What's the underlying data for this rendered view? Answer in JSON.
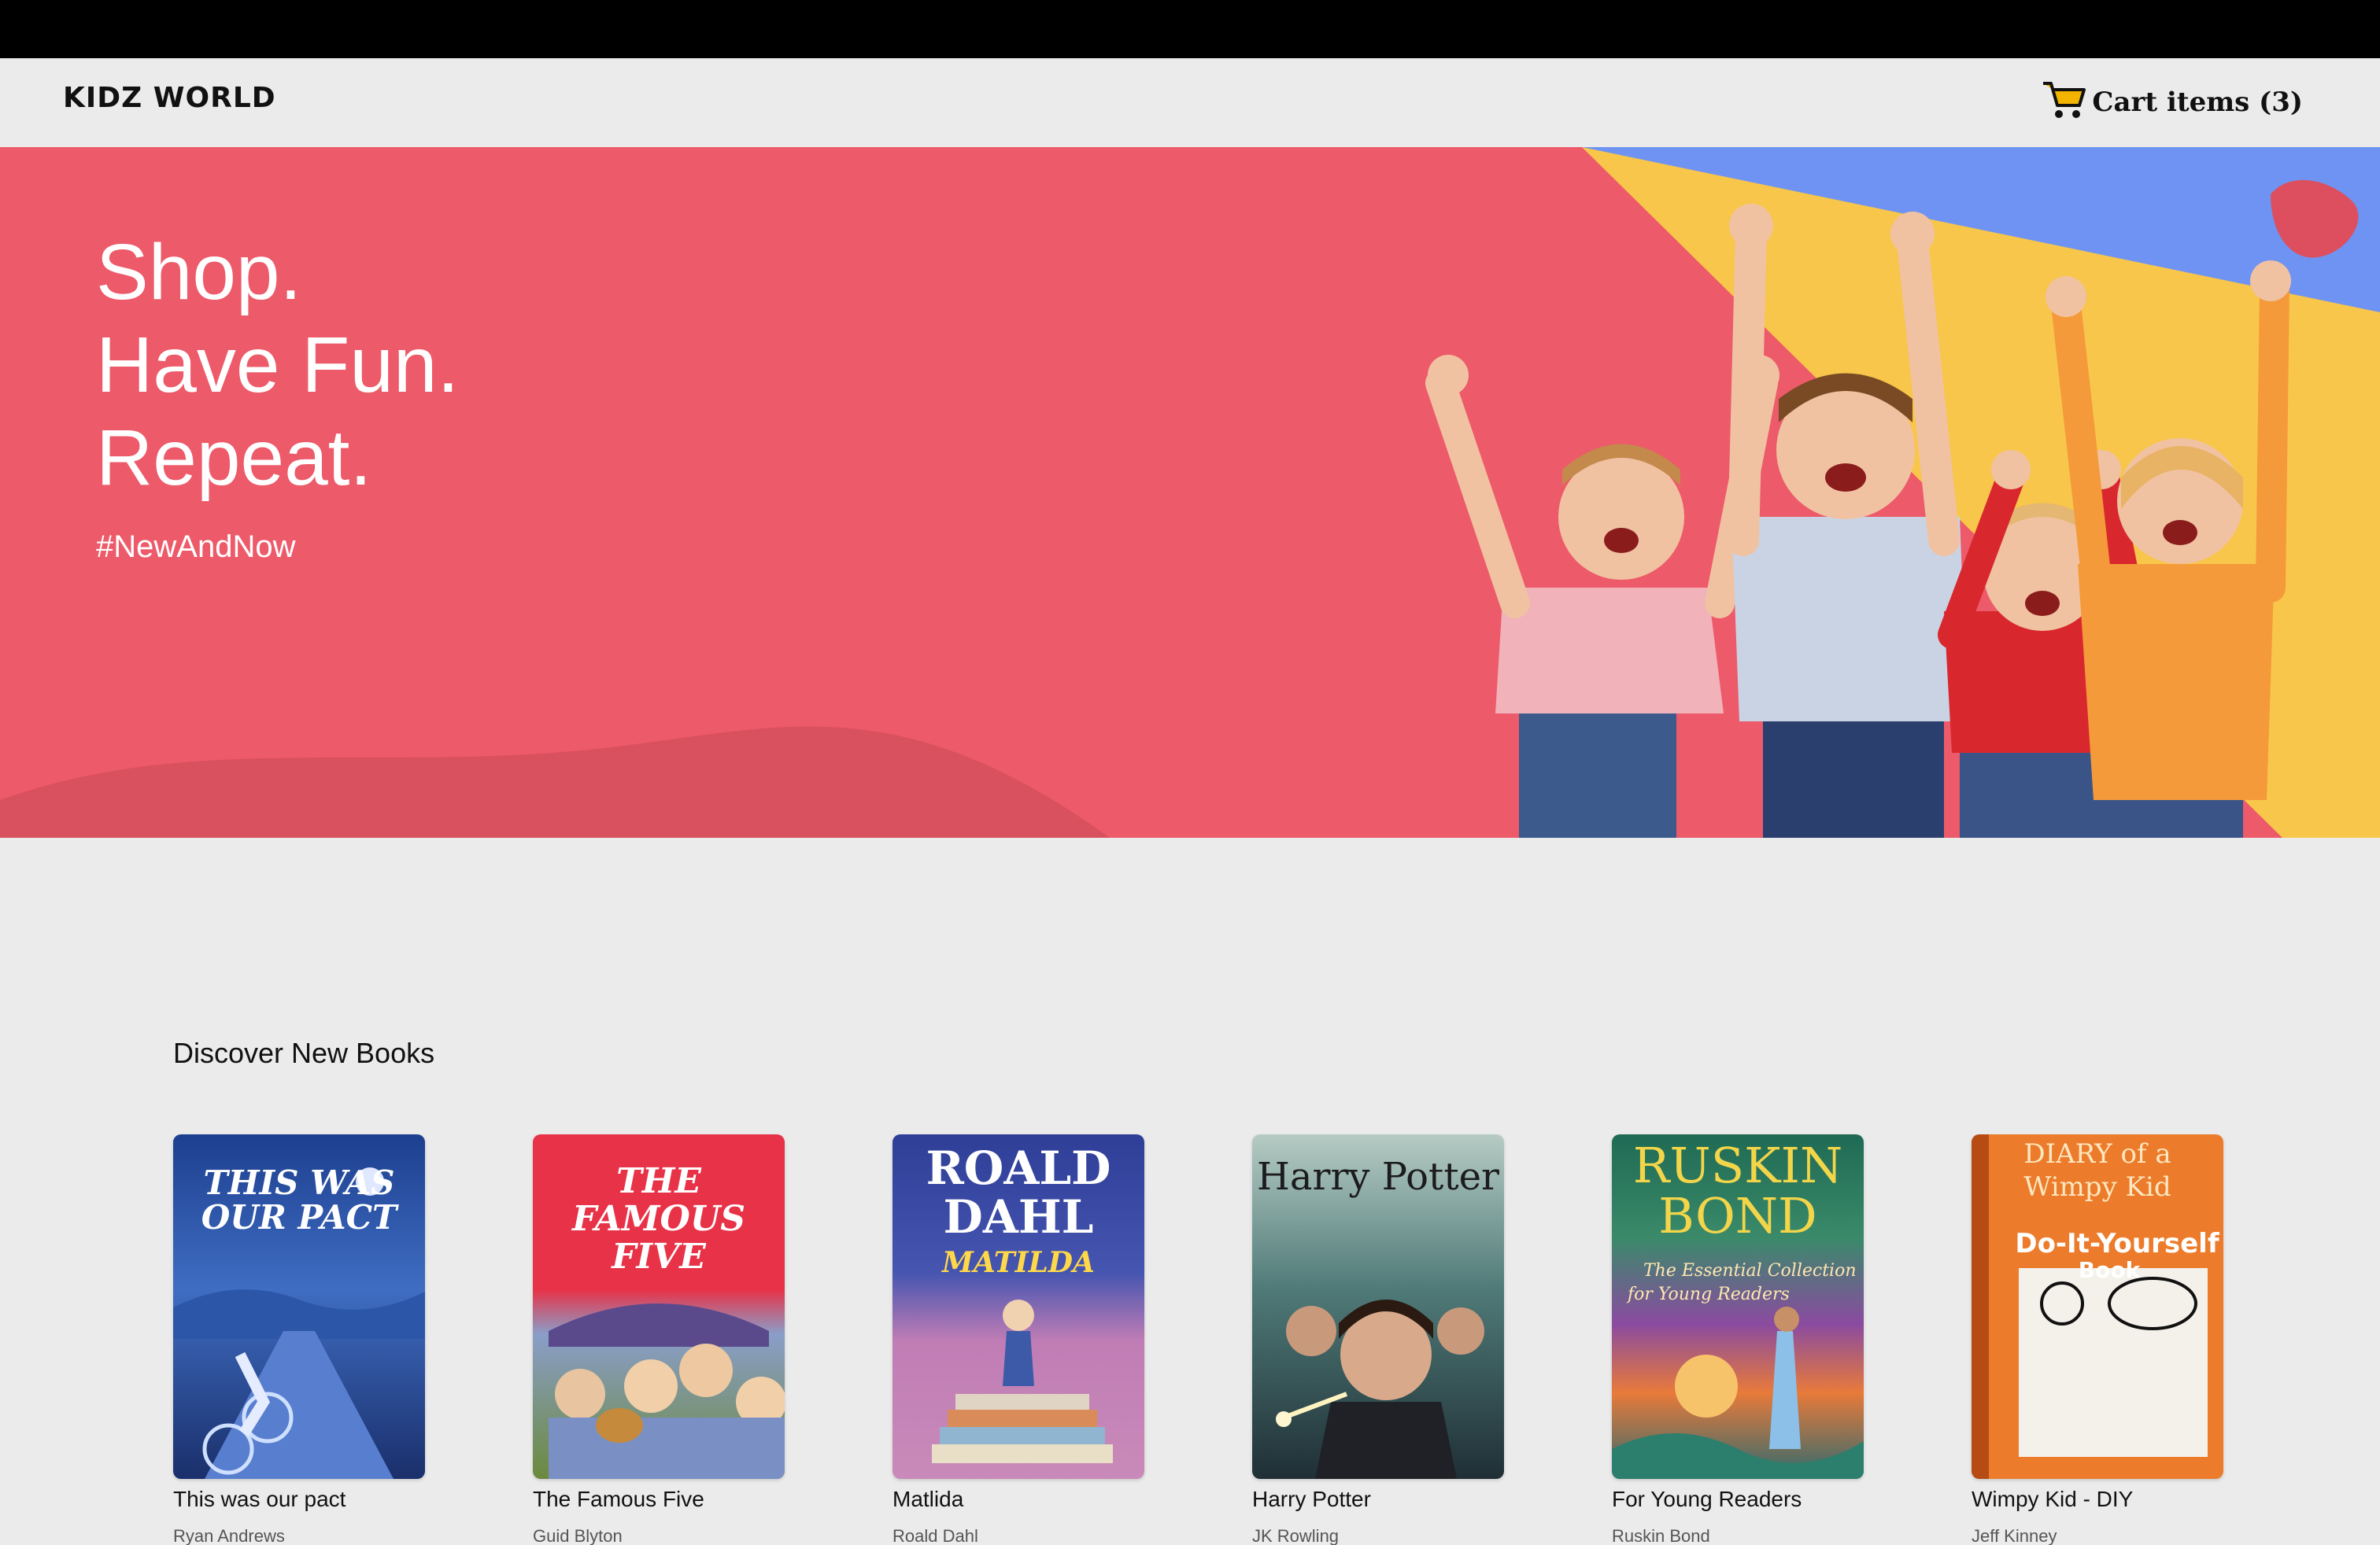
{
  "brand": {
    "logo_text": "KIDZ WORLD"
  },
  "header": {
    "cart_label": "Cart items (3)",
    "cart_icon": "shopping-cart-icon"
  },
  "hero": {
    "lines": [
      "Shop.",
      "Have Fun.",
      "Repeat."
    ],
    "hashtag": "#NewAndNow",
    "colors": {
      "primary": "#ed5a69",
      "accent_yellow": "#f8c64a",
      "accent_blue": "#6e93f2"
    }
  },
  "section": {
    "title": "Discover New Books"
  },
  "books": [
    {
      "title": "This was our pact",
      "author": "Ryan Andrews",
      "cover_text": "THIS WAS OUR PACT"
    },
    {
      "title": "The Famous Five",
      "author": "Guid Blyton",
      "cover_text": "THE FAMOUS FIVE"
    },
    {
      "title": "Matlida",
      "author": "Roald Dahl",
      "cover_text": "ROALD DAHL"
    },
    {
      "title": "Harry Potter",
      "author": "JK Rowling",
      "cover_text": "Harry Potter"
    },
    {
      "title": "For Young Readers",
      "author": "Ruskin Bond",
      "cover_text": "RUSKIN BOND"
    },
    {
      "title": "Wimpy Kid - DIY",
      "author": "Jeff Kinney",
      "cover_text": "DIARY of a Wimpy Kid"
    }
  ]
}
